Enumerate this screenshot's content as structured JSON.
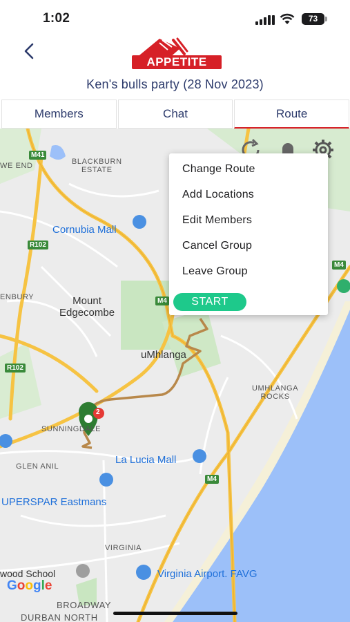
{
  "status_bar": {
    "time": "1:02",
    "battery": "73"
  },
  "header": {
    "back_icon": "chevron-left-icon",
    "logo_text": "APPETITE",
    "event_title": "Ken's bulls party (28 Nov 2023)"
  },
  "tabs": [
    {
      "label": "Members"
    },
    {
      "label": "Chat"
    },
    {
      "label": "Route",
      "active": true
    }
  ],
  "menu": {
    "items": [
      "Change Route",
      "Add Locations",
      "Edit Members",
      "Cancel Group",
      "Leave Group"
    ],
    "start_label": "START"
  },
  "map": {
    "labels": {
      "blackburn": "BLACKBURN\nESTATE",
      "we_end": "WE END",
      "cornubia": "Cornubia Mall",
      "enbury": "ENBURY",
      "mount_edgecombe": "Mount\nEdgecombe",
      "umhlanga": "uMhlanga",
      "umhlanga_rocks": "UMHLANGA\nROCKS",
      "sunningdale": "SUNNINGDALE",
      "la_lucia": "La Lucia Mall",
      "glen_anil": "GLEN ANIL",
      "superspar": "UPERSPAR Eastmans",
      "virginia": "VIRGINIA",
      "wood_school": "wood School",
      "virginia_airport": "Virginia Airport. FAVG",
      "broadway": "BROADWAY",
      "durban_north": "DURBAN NORTH"
    },
    "shields": {
      "m41": "M41",
      "r102_a": "R102",
      "r102_b": "R102",
      "m4_a": "M4",
      "m4_b": "M4",
      "m4_c": "M4"
    },
    "google": [
      "G",
      "o",
      "o",
      "g",
      "l",
      "e"
    ],
    "marker_count": "2"
  },
  "colors": {
    "accent": "#d62027",
    "start": "#1ec98b",
    "title": "#2c3a6b",
    "route": "#b8884a",
    "sea": "#9cc0f9",
    "road": "#f6c343"
  }
}
